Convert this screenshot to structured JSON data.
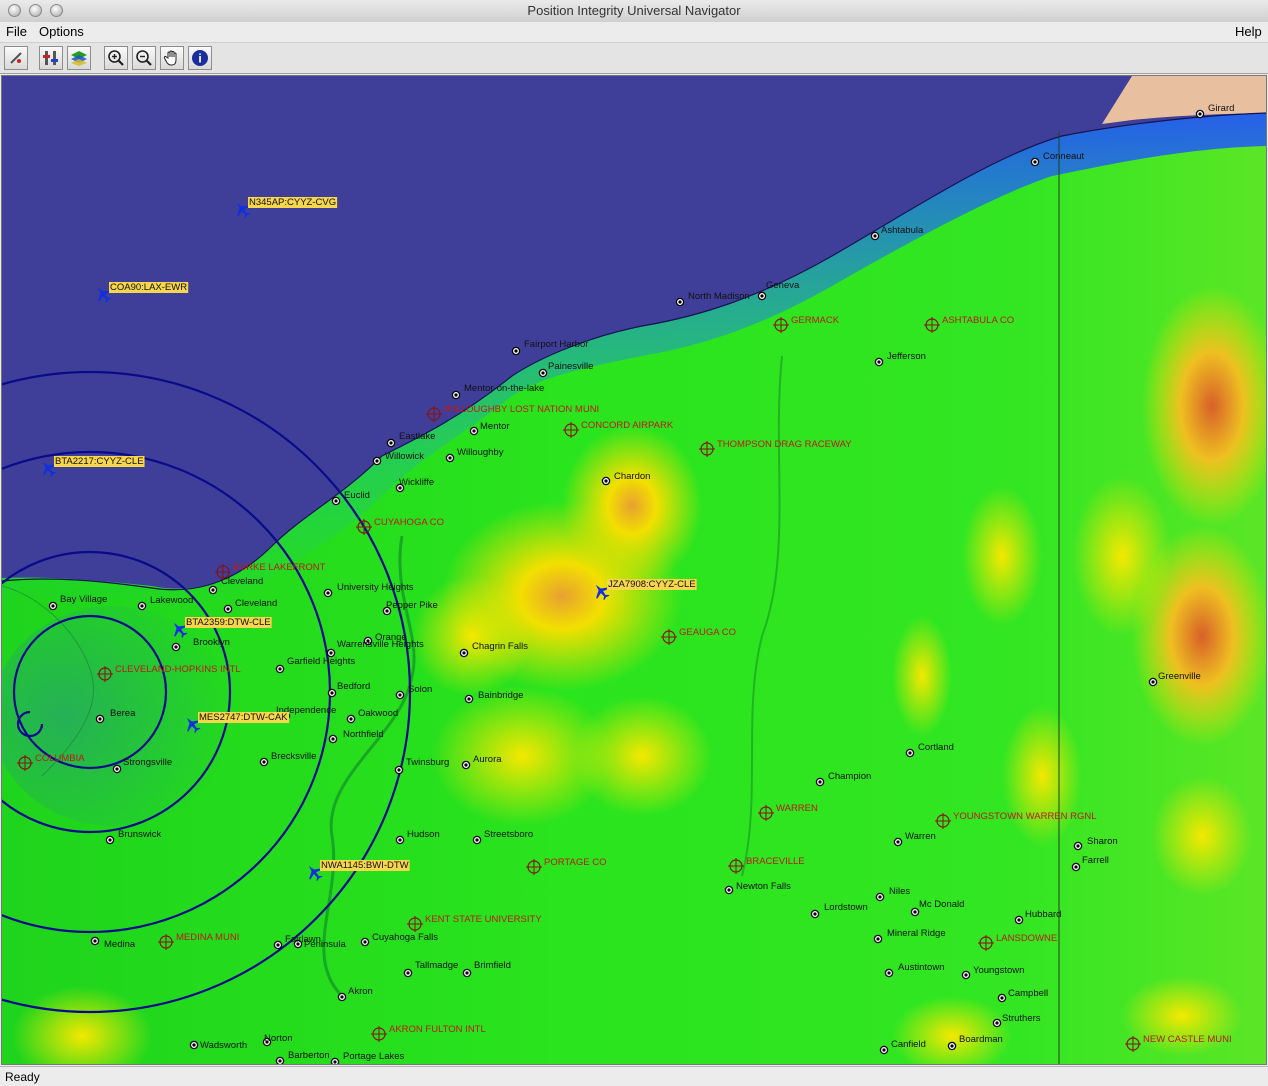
{
  "window": {
    "title": "Position Integrity Universal Navigator"
  },
  "menu": {
    "file": "File",
    "options": "Options",
    "help": "Help"
  },
  "toolbar": {
    "icons": [
      "edit-icon",
      "layers-adjust-icon",
      "layers-icon",
      "zoom-in-icon",
      "zoom-out-icon",
      "pan-hand-icon",
      "info-icon"
    ]
  },
  "status": {
    "text": "Ready"
  },
  "colors": {
    "water": "#3f3f9a",
    "lowland": "#22e01c",
    "highland": "#f2e800",
    "peak": "#e07a20",
    "route": "#0a0a8a",
    "aircraft": "#1030e0",
    "flight_label_bg": "#f6d64a",
    "airport_label": "#c01818"
  },
  "map": {
    "towns": [
      {
        "name": "Girard"
      },
      {
        "name": "Conneaut"
      },
      {
        "name": "Ashtabula"
      },
      {
        "name": "North Madison"
      },
      {
        "name": "Geneva"
      },
      {
        "name": "Jefferson"
      },
      {
        "name": "Fairport Harbor"
      },
      {
        "name": "Painesville"
      },
      {
        "name": "Mentor-on-the-lake"
      },
      {
        "name": "Mentor"
      },
      {
        "name": "Eastlake"
      },
      {
        "name": "Willowick"
      },
      {
        "name": "Willoughby"
      },
      {
        "name": "Euclid"
      },
      {
        "name": "Wickliffe"
      },
      {
        "name": "Chardon"
      },
      {
        "name": "Cleveland"
      },
      {
        "name": "Cleveland"
      },
      {
        "name": "Bay Village"
      },
      {
        "name": "Lakewood"
      },
      {
        "name": "University Heights"
      },
      {
        "name": "Pepper Pike"
      },
      {
        "name": "Brooklyn"
      },
      {
        "name": "Orange"
      },
      {
        "name": "Warrensville Heights"
      },
      {
        "name": "Chagrin Falls"
      },
      {
        "name": "Garfield Heights"
      },
      {
        "name": "Bedford"
      },
      {
        "name": "Solon"
      },
      {
        "name": "Bainbridge"
      },
      {
        "name": "Berea"
      },
      {
        "name": "Independence"
      },
      {
        "name": "Oakwood"
      },
      {
        "name": "Northfield"
      },
      {
        "name": "Strongsville"
      },
      {
        "name": "Brecksville"
      },
      {
        "name": "Twinsburg"
      },
      {
        "name": "Aurora"
      },
      {
        "name": "Cortland"
      },
      {
        "name": "Champion"
      },
      {
        "name": "Greenville"
      },
      {
        "name": "Brunswick"
      },
      {
        "name": "Peninsula"
      },
      {
        "name": "Hudson"
      },
      {
        "name": "Streetsboro"
      },
      {
        "name": "Warren"
      },
      {
        "name": "Sharon"
      },
      {
        "name": "Farrell"
      },
      {
        "name": "Newton Falls"
      },
      {
        "name": "Niles"
      },
      {
        "name": "Lordstown"
      },
      {
        "name": "Mc Donald"
      },
      {
        "name": "Hubbard"
      },
      {
        "name": "Mineral Ridge"
      },
      {
        "name": "Medina"
      },
      {
        "name": "Fairlawn"
      },
      {
        "name": "Cuyahoga Falls"
      },
      {
        "name": "Tallmadge"
      },
      {
        "name": "Brimfield"
      },
      {
        "name": "Austintown"
      },
      {
        "name": "Youngstown"
      },
      {
        "name": "Akron"
      },
      {
        "name": "Campbell"
      },
      {
        "name": "Struthers"
      },
      {
        "name": "Wadsworth"
      },
      {
        "name": "Norton"
      },
      {
        "name": "Barberton"
      },
      {
        "name": "Portage Lakes"
      },
      {
        "name": "Canfield"
      },
      {
        "name": "Boardman"
      }
    ],
    "airports": [
      {
        "name": "GERMACK"
      },
      {
        "name": "ASHTABULA CO"
      },
      {
        "name": "WILLOUGHBY LOST NATION MUNI"
      },
      {
        "name": "CONCORD AIRPARK"
      },
      {
        "name": "THOMPSON DRAG RACEWAY"
      },
      {
        "name": "CUYAHOGA CO"
      },
      {
        "name": "BURKE LAKEFRONT"
      },
      {
        "name": "GEAUGA CO"
      },
      {
        "name": "CLEVELAND-HOPKINS INTL"
      },
      {
        "name": "COLUMBIA"
      },
      {
        "name": "WARREN"
      },
      {
        "name": "YOUNGSTOWN WARREN RGNL"
      },
      {
        "name": "PORTAGE CO"
      },
      {
        "name": "BRACEVILLE"
      },
      {
        "name": "KENT STATE UNIVERSITY"
      },
      {
        "name": "MEDINA MUNI"
      },
      {
        "name": "LANSDOWNE"
      },
      {
        "name": "AKRON FULTON INTL"
      },
      {
        "name": "NEW CASTLE MUNI"
      }
    ],
    "flights": [
      {
        "label": "N345AP:CYYZ-CVG"
      },
      {
        "label": "COA90:LAX-EWR"
      },
      {
        "label": "BTA2217:CYYZ-CLE"
      },
      {
        "label": "BTA2359:DTW-CLE"
      },
      {
        "label": "MES2747:DTW-CAK"
      },
      {
        "label": "JZA7908:CYYZ-CLE"
      },
      {
        "label": "NWA1145:BWI-DTW"
      }
    ]
  }
}
